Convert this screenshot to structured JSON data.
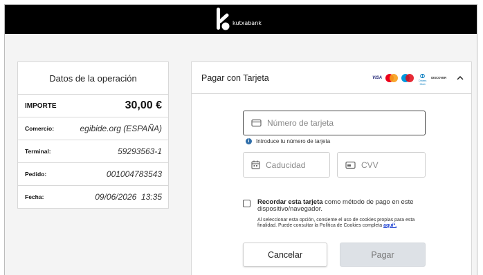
{
  "header": {
    "brand_text": "kutxabank"
  },
  "summary": {
    "title": "Datos de la operación",
    "rows": [
      {
        "key": "IMPORTE",
        "value": "30,00 €"
      },
      {
        "key": "Comercio:",
        "value": "egibide.org (ESPAÑA)"
      },
      {
        "key": "Terminal:",
        "value": "59293563-1"
      },
      {
        "key": "Pedido:",
        "value": "001004783543"
      },
      {
        "key": "Fecha:",
        "value": "09/06/2026  13:35"
      }
    ]
  },
  "payment": {
    "title": "Pagar con Tarjeta",
    "logos": {
      "visa": "VISA",
      "diners": "Diners Club",
      "discover": "DISCOVER"
    },
    "card_placeholder": "Número de tarjeta",
    "card_hint": "Introduce tu número de tarjeta",
    "expiry_placeholder": "Caducidad",
    "cvv_placeholder": "CVV",
    "remember_bold": "Recordar esta tarjeta",
    "remember_rest": " como método de pago en este dispositivo/navegador.",
    "cookie_text": "Al seleccionar esta opción, consiente el uso de cookies propias para esta finalidad. Puede consultar la Política de Cookies completa ",
    "cookie_link": "aquí*.",
    "cancel_label": "Cancelar",
    "pay_label": "Pagar"
  },
  "colors": {
    "topbar": "#000000",
    "link": "#1a3fd1",
    "info": "#2f6ea9"
  }
}
